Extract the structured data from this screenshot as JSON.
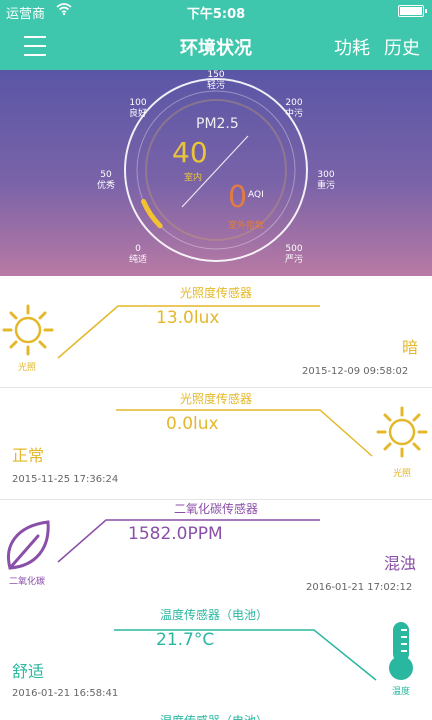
{
  "status_bar": {
    "carrier": "运营商",
    "time": "下午5:08"
  },
  "nav": {
    "title": "环境状况",
    "power_label": "功耗",
    "history_label": "历史"
  },
  "gauge": {
    "title": "PM2.5",
    "indoor_value": "40",
    "indoor_label": "室内",
    "aqi_value": "0",
    "aqi_label": "AQI",
    "outdoor_label": "室外指数",
    "level": 0.08,
    "ticks": [
      {
        "value": "0",
        "label": "纯适"
      },
      {
        "value": "50",
        "label": "优秀"
      },
      {
        "value": "100",
        "label": "良好"
      },
      {
        "value": "150",
        "label": "轻污"
      },
      {
        "value": "200",
        "label": "中污"
      },
      {
        "value": "300",
        "label": "重污"
      },
      {
        "value": "500",
        "label": "严污"
      }
    ]
  },
  "cards": [
    {
      "title": "光照度传感器",
      "value": "13.0lux",
      "status": "暗",
      "time": "2015-12-09 09:58:02",
      "icon_label": "光照",
      "icon": "sun-icon",
      "color": "#e3b82a"
    },
    {
      "title": "光照度传感器",
      "value": "0.0lux",
      "status": "正常",
      "time": "2015-11-25 17:36:24",
      "icon_label": "光照",
      "icon": "sun-icon",
      "color": "#e3b82a"
    },
    {
      "title": "二氧化碳传感器",
      "value": "1582.0PPM",
      "status": "混浊",
      "time": "2016-01-21 17:02:12",
      "icon_label": "二氧化碳",
      "icon": "leaf-icon",
      "color": "#8a4fa8"
    },
    {
      "title": "温度传感器（电池）",
      "value": "21.7°C",
      "status": "舒适",
      "time": "2016-01-21 16:58:41",
      "icon_label": "温度",
      "icon": "thermometer-icon",
      "color": "#2ab7a0"
    },
    {
      "title": "湿度传感器（电池）"
    }
  ]
}
